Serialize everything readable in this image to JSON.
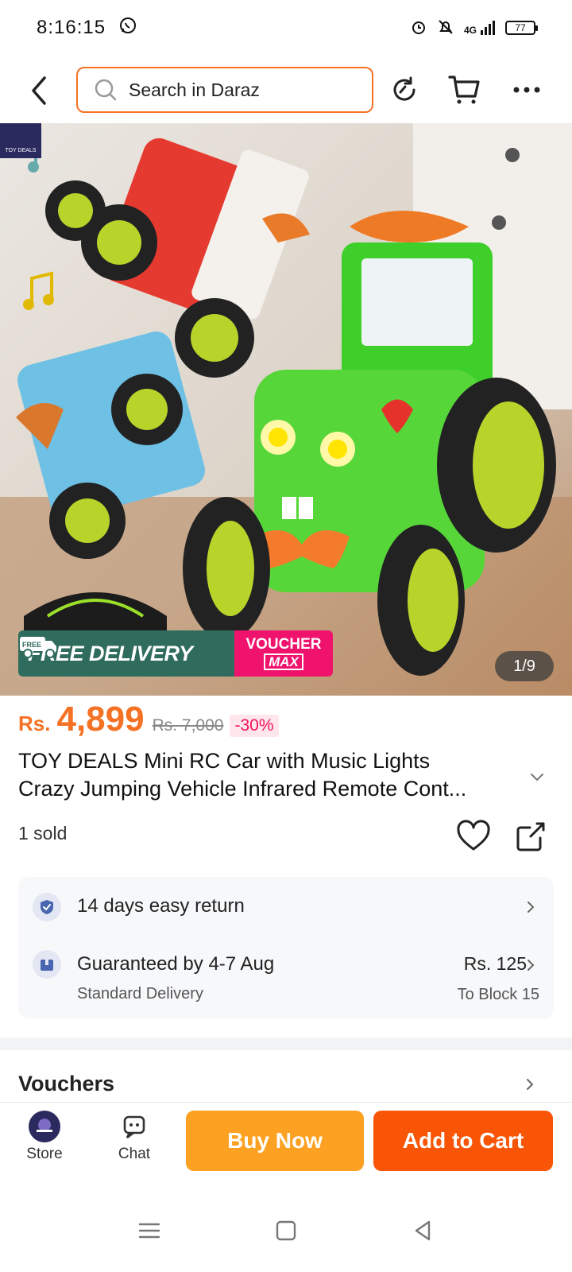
{
  "status_bar": {
    "time": "8:16:15",
    "network": "4G",
    "battery": "77",
    "icons": [
      "whatsapp-icon",
      "alarm-icon",
      "mute-icon",
      "signal-icon",
      "battery-icon"
    ]
  },
  "header": {
    "search_placeholder": "Search in Daraz",
    "icons": [
      "back-arrow-icon",
      "search-icon",
      "refresh-icon",
      "cart-icon",
      "more-icon"
    ]
  },
  "gallery": {
    "brand_tag": "TOY DEALS",
    "promo_free_label": "FREE",
    "promo_delivery": "FREE DELIVERY",
    "promo_voucher": "VOUCHER",
    "promo_max": "MAX",
    "counter": "1/9"
  },
  "product": {
    "currency": "Rs.",
    "price": "4,899",
    "original_price": "Rs. 7,000",
    "discount": "-30%",
    "title_line1": "TOY DEALS Mini RC Car with Music Lights",
    "title_line2": "Crazy Jumping Vehicle Infrared Remote Cont...",
    "sold": "1 sold"
  },
  "service": {
    "returns": "14 days easy return",
    "guarantee": "Guaranteed by 4-7 Aug",
    "delivery_type": "Standard Delivery",
    "delivery_fee": "Rs. 125",
    "delivery_to": "To Block 15"
  },
  "vouchers_section": {
    "title": "Vouchers"
  },
  "bottom_bar": {
    "store_label": "Store",
    "chat_label": "Chat",
    "buy_now": "Buy Now",
    "add_to_cart": "Add to Cart"
  },
  "colors": {
    "accent": "#f57224",
    "buy_now": "#fca122",
    "add_to_cart": "#f85606",
    "voucher_pink": "#f0136d",
    "delivery_green": "#2f6c5d"
  }
}
